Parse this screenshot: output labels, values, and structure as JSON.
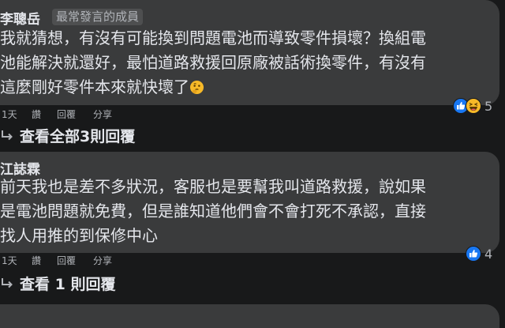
{
  "comments": [
    {
      "author": "李聰岳",
      "badge": "最常發言的成員",
      "lines": [
        "我就猜想，有沒有可能換到問題電池而導致零件損壞？換組電",
        "池能解決就還好，最怕道路救援回原廠被話術換零件，有沒有",
        "這麼剛好零件本來就快壞了"
      ],
      "trailing_emoji": "thinking-face",
      "time": "1天",
      "like_label": "讚",
      "reply_label": "回覆",
      "share_label": "分享",
      "reaction_icons": [
        "like-icon",
        "haha-icon"
      ],
      "reaction_count": "5",
      "view_replies": "查看全部3則回覆"
    },
    {
      "author": "江誌霖",
      "lines": [
        "前天我也是差不多狀況，客服也是要幫我叫道路救援，說如果",
        "是電池問題就免費，但是誰知道他們會不會打死不承認，直接",
        "找人用推的到保修中心"
      ],
      "time": "1天",
      "like_label": "讚",
      "reply_label": "回覆",
      "share_label": "分享",
      "reaction_icons": [
        "like-icon"
      ],
      "reaction_count": "4",
      "view_replies": "查看 1 則回覆"
    }
  ],
  "colors": {
    "background": "#18191a",
    "bubble": "#3a3b3c",
    "text": "#e4e6eb",
    "secondary_text": "#b0b3b8",
    "like_blue": "#1877f2"
  }
}
